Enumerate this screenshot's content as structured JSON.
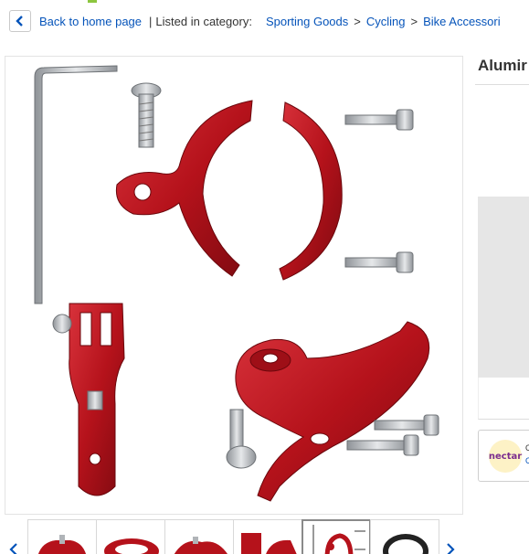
{
  "breadcrumb": {
    "back_label": "Back to home page",
    "separator": "|",
    "listed_label": "Listed in category:",
    "categories": [
      "Sporting Goods",
      "Cycling",
      "Bike Accessori"
    ],
    "gt": ">"
  },
  "product": {
    "title_partial": "Alumir"
  },
  "nectar": {
    "logo_text": "nectar",
    "line1": "C",
    "line2": "C"
  },
  "thumbnails": {
    "count": 6,
    "active_index": 4,
    "prev_icon": "chevron-left-icon",
    "next_icon": "chevron-right-icon"
  },
  "colors": {
    "link": "#0654ba",
    "part_red": "#b5121b",
    "metal": "#b0b4b8",
    "panel_grey": "#e6e6e6"
  }
}
